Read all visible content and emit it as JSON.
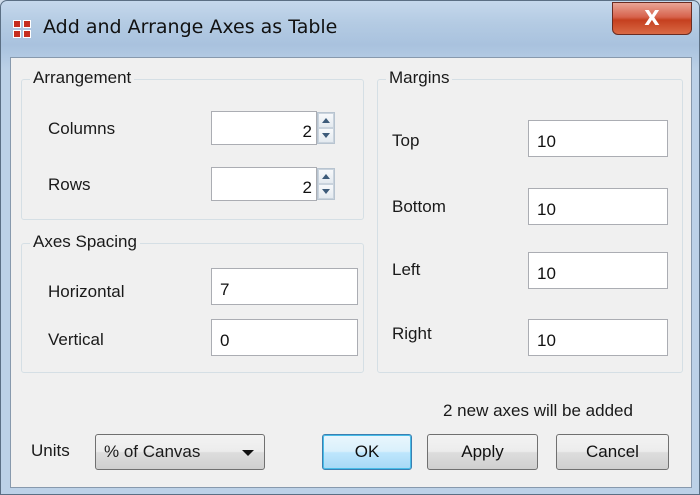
{
  "window": {
    "title": "Add and Arrange Axes as Table",
    "close_label": "X"
  },
  "arrangement": {
    "title": "Arrangement",
    "columns_label": "Columns",
    "columns_value": "2",
    "rows_label": "Rows",
    "rows_value": "2"
  },
  "spacing": {
    "title": "Axes Spacing",
    "horizontal_label": "Horizontal",
    "horizontal_value": "7",
    "vertical_label": "Vertical",
    "vertical_value": "0"
  },
  "margins": {
    "title": "Margins",
    "top_label": "Top",
    "top_value": "10",
    "bottom_label": "Bottom",
    "bottom_value": "10",
    "left_label": "Left",
    "left_value": "10",
    "right_label": "Right",
    "right_value": "10"
  },
  "status": "2 new axes will be added",
  "units": {
    "label": "Units",
    "selected": "% of Canvas"
  },
  "buttons": {
    "ok": "OK",
    "apply": "Apply",
    "cancel": "Cancel"
  },
  "icons": {
    "app_icon": "table-grid-icon",
    "close_icon": "close-icon"
  },
  "colors": {
    "icon_red": "#c62d1f",
    "default_button_accent": "#3c7fb1"
  }
}
